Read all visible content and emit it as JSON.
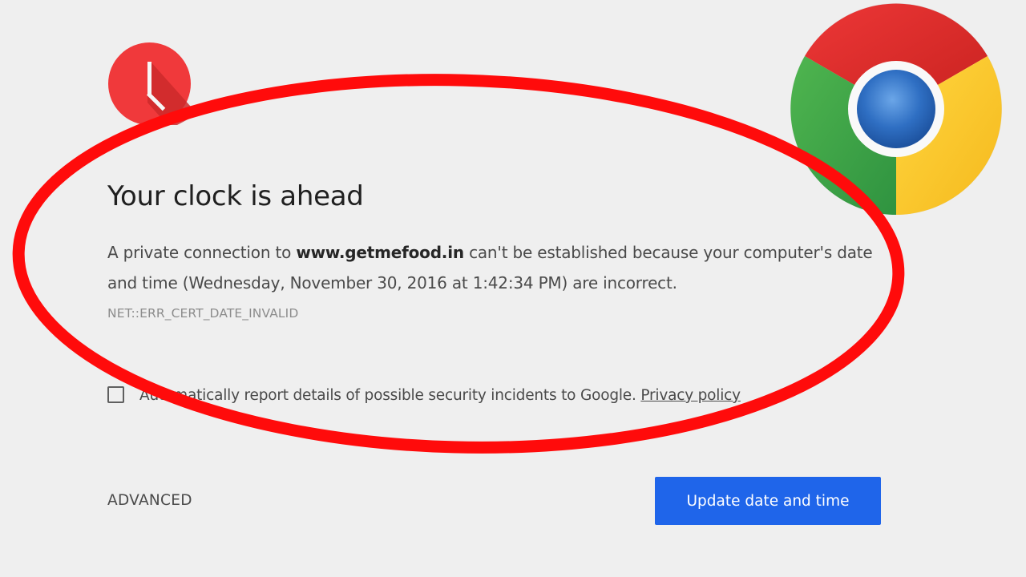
{
  "page": {
    "title": "Your clock is ahead",
    "message": {
      "prefix": "A private connection to ",
      "domain": "www.getmefood.in",
      "suffix": " can't be established because your computer's date and time (Wednesday, November 30, 2016 at 1:42:34 PM) are incorrect."
    },
    "error_code": "NET::ERR_CERT_DATE_INVALID",
    "report": {
      "label": "Automatically report details of possible security incidents to Google.",
      "link": "Privacy policy",
      "checked": false
    },
    "advanced_label": "ADVANCED",
    "primary_button_label": "Update date and time"
  },
  "icons": {
    "clock": "clock-icon",
    "chrome": "chrome-logo"
  },
  "colors": {
    "background": "#efefef",
    "clock_red": "#f0393b",
    "annotation_red": "#ff0b0b",
    "button_blue": "#1f65ea"
  }
}
